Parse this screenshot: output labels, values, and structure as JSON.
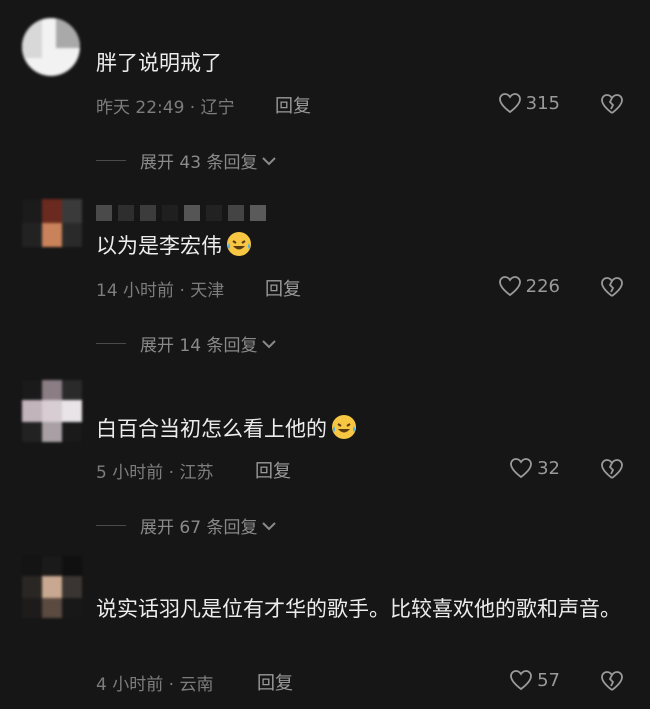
{
  "comments": [
    {
      "text": "胖了说明戒了",
      "time": "昨天 22:49",
      "location": "辽宁",
      "reply_label": "回复",
      "likes": "315",
      "expand_label": "展开 43 条回复"
    },
    {
      "text": "以为是李宏伟",
      "time": "14 小时前",
      "location": "天津",
      "reply_label": "回复",
      "likes": "226",
      "expand_label": "展开 14 条回复",
      "emoji": "laughing-tears-emoji"
    },
    {
      "text": "白百合当初怎么看上他的",
      "time": "5 小时前",
      "location": "江苏",
      "reply_label": "回复",
      "likes": "32",
      "expand_label": "展开 67 条回复",
      "emoji": "laughing-tears-emoji"
    },
    {
      "text": "说实话羽凡是位有才华的歌手。比较喜欢他的歌和声音。",
      "time": "4 小时前",
      "location": "云南",
      "reply_label": "回复",
      "likes": "57"
    }
  ],
  "meta_separator": " · ",
  "colors": {
    "background": "#161616",
    "text": "#ececec",
    "muted": "#7d7d7d"
  }
}
